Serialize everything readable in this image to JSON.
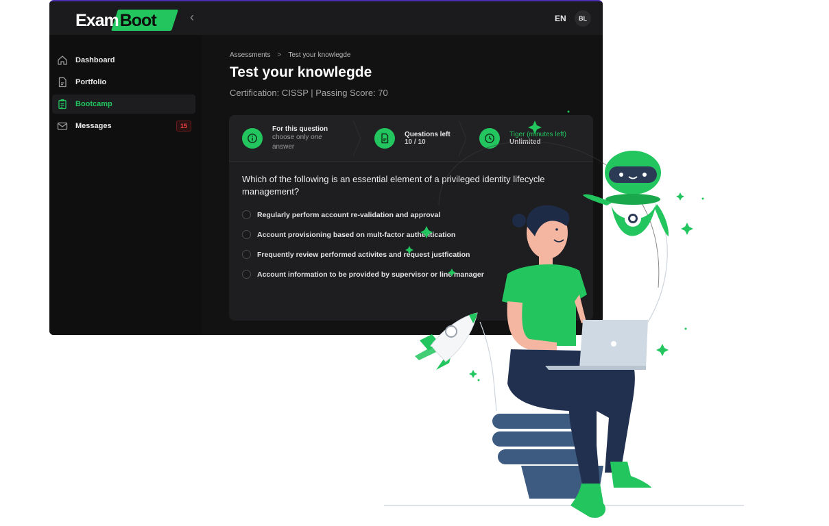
{
  "header": {
    "logo_part1": "Exam",
    "logo_part2": "Boot",
    "collapse_glyph": "‹",
    "language": "EN",
    "avatar_initials": "BL"
  },
  "sidebar": {
    "items": [
      {
        "label": "Dashboard",
        "icon": "home-icon",
        "active": false
      },
      {
        "label": "Portfolio",
        "icon": "document-icon",
        "active": false
      },
      {
        "label": "Bootcamp",
        "icon": "clipboard-icon",
        "active": true
      },
      {
        "label": "Messages",
        "icon": "mail-icon",
        "active": false,
        "badge": "15"
      }
    ]
  },
  "main": {
    "breadcrumb": [
      "Assessments",
      "Test your knowlegde"
    ],
    "breadcrumb_separator": ">",
    "title": "Test your knowlegde",
    "subtitle": "Certification: CISSP | Passing Score: 70",
    "info": {
      "rule_title": "For this question",
      "rule_line1_prefix": "choose only ",
      "rule_line1_emph": "one",
      "rule_line2": "answer",
      "questions_title": "Questions left",
      "questions_value": "10 / 10",
      "timer_title": "Tiger (minutes left)",
      "timer_value": "Unlimited"
    },
    "question": "Which of the following is an essential element of a privileged identity lifecycle management?",
    "options": [
      "Regularly perform account re-validation and approval",
      "Account provisioning based on mult-factor authentication",
      "Frequently review performed activites and request justfication",
      "Account information to be provided by supervisor or line manager"
    ]
  },
  "colors": {
    "accent": "#22c55e",
    "background": "#121212",
    "badge": "#ef4444"
  }
}
